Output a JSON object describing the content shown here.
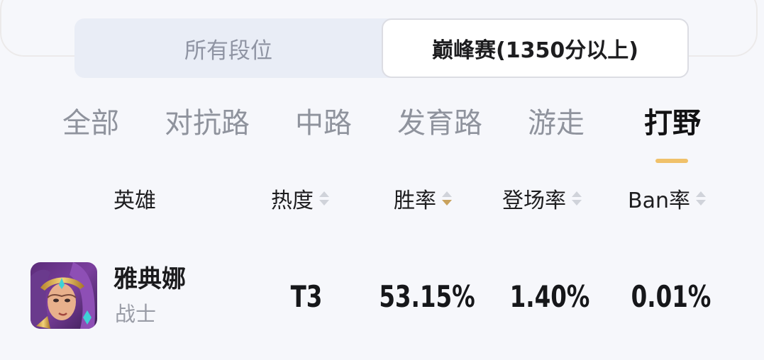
{
  "rank_filter": {
    "options": [
      {
        "label": "所有段位",
        "selected": false
      },
      {
        "label": "巅峰赛(1350分以上)",
        "selected": true
      }
    ]
  },
  "lanes": {
    "tabs": [
      {
        "label": "全部",
        "active": false
      },
      {
        "label": "对抗路",
        "active": false
      },
      {
        "label": "中路",
        "active": false
      },
      {
        "label": "发育路",
        "active": false
      },
      {
        "label": "游走",
        "active": false
      },
      {
        "label": "打野",
        "active": true
      }
    ]
  },
  "table": {
    "headers": {
      "hero": "英雄",
      "heat": "热度",
      "win_rate": "胜率",
      "pick_rate": "登场率",
      "ban_rate": "Ban率"
    },
    "sorted_by": "win_rate",
    "sort_direction": "descending",
    "rows": [
      {
        "name": "雅典娜",
        "role": "战士",
        "avatar_icon": "hero-portrait",
        "tier": "T3",
        "win_rate": "53.15%",
        "pick_rate": "1.40%",
        "ban_rate": "0.01%"
      }
    ]
  },
  "colors": {
    "accent": "#f0c16a",
    "sort_active": "#c9a25d",
    "segment_bg": "#e9edf6",
    "text_muted": "#8f939d"
  }
}
